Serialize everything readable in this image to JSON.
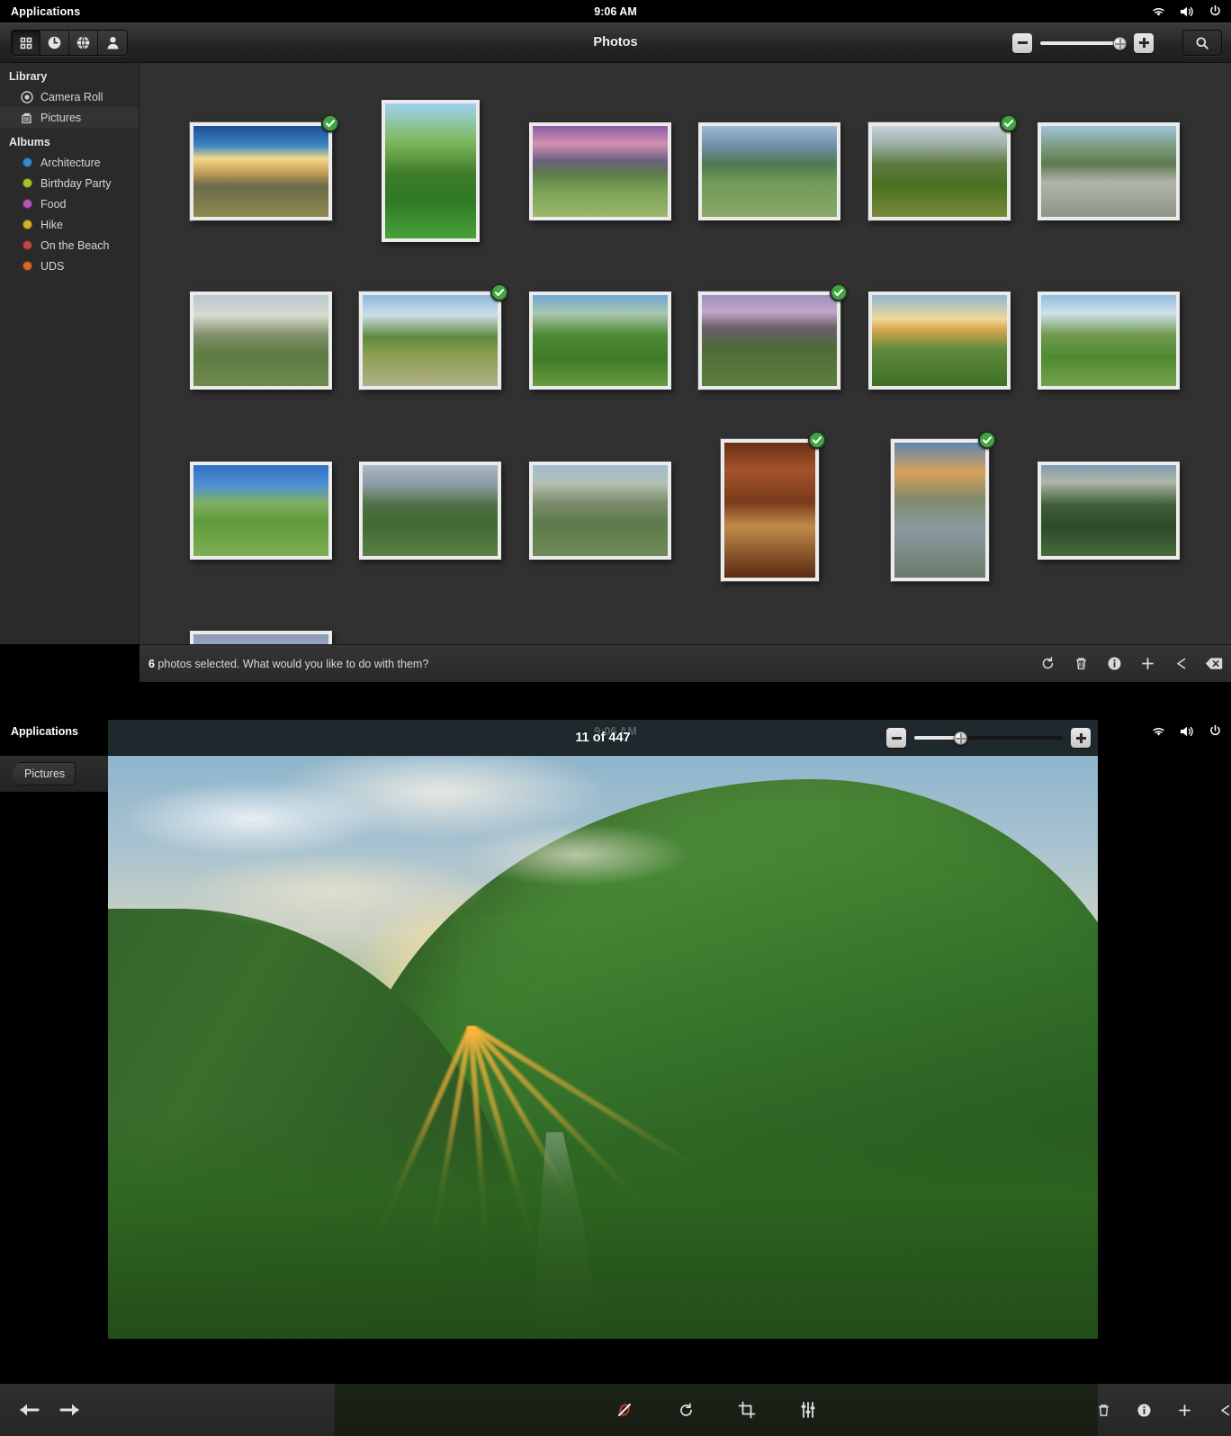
{
  "system": {
    "applications_label": "Applications",
    "clock": "9:06 AM",
    "tray_icons": [
      "wifi-icon",
      "volume-icon",
      "power-icon"
    ]
  },
  "window_grid": {
    "title": "Photos",
    "toolbar_buttons": [
      {
        "name": "grid-view-button",
        "icon": "grid-icon",
        "active": true
      },
      {
        "name": "recent-view-button",
        "icon": "clock-icon",
        "active": false
      },
      {
        "name": "places-view-button",
        "icon": "globe-icon",
        "active": false
      },
      {
        "name": "people-view-button",
        "icon": "person-icon",
        "active": false
      }
    ],
    "zoom": {
      "minus_label": "−",
      "plus_label": "+",
      "value_percent": 93
    },
    "search_icon": "search-icon",
    "sidebar": {
      "library_heading": "Library",
      "library_items": [
        {
          "label": "Camera Roll",
          "icon": "camera-roll-icon",
          "selected": false
        },
        {
          "label": "Pictures",
          "icon": "pictures-folder-icon",
          "selected": true
        }
      ],
      "albums_heading": "Albums",
      "albums": [
        {
          "label": "Architecture",
          "color": "#3a89c9"
        },
        {
          "label": "Birthday Party",
          "color": "#a5c32a"
        },
        {
          "label": "Food",
          "color": "#b martial"
        },
        {
          "label": "Hike",
          "color": "#d4b125"
        },
        {
          "label": "On the Beach",
          "color": "#bd4a45"
        },
        {
          "label": "UDS",
          "color": "#d4692a"
        }
      ]
    },
    "action_bar": {
      "count": "6",
      "message": " photos selected. What would you like to do with them?",
      "actions": [
        {
          "name": "rotate-button",
          "icon": "rotate-icon"
        },
        {
          "name": "delete-button",
          "icon": "trash-icon"
        },
        {
          "name": "properties-button",
          "icon": "info-icon"
        },
        {
          "name": "add-to-album-button",
          "icon": "plus-icon"
        },
        {
          "name": "share-button",
          "icon": "share-icon"
        },
        {
          "name": "deselect-button",
          "icon": "clear-selection-icon"
        }
      ]
    },
    "photos": [
      {
        "id": 1,
        "row": 0,
        "col": 0,
        "orientation": "landscape",
        "selected": true,
        "alt": "Sunset over rocky coastline"
      },
      {
        "id": 2,
        "row": 0,
        "col": 1,
        "orientation": "portrait",
        "selected": false,
        "alt": "Tree and boulders on green grass"
      },
      {
        "id": 3,
        "row": 0,
        "col": 2,
        "orientation": "landscape",
        "selected": false,
        "alt": "Purple sunset over field with tree"
      },
      {
        "id": 4,
        "row": 0,
        "col": 3,
        "orientation": "landscape",
        "selected": false,
        "alt": "Gravel path through green meadow"
      },
      {
        "id": 5,
        "row": 0,
        "col": 4,
        "orientation": "landscape",
        "selected": true,
        "alt": "Mountain ridge trail"
      },
      {
        "id": 6,
        "row": 0,
        "col": 5,
        "orientation": "landscape",
        "selected": false,
        "alt": "Rocky lake shore with mountains"
      },
      {
        "id": 7,
        "row": 1,
        "col": 0,
        "orientation": "landscape",
        "selected": false,
        "alt": "Hazy sunrise over valley"
      },
      {
        "id": 8,
        "row": 1,
        "col": 1,
        "orientation": "landscape",
        "selected": true,
        "alt": "Rocky stream with trees"
      },
      {
        "id": 9,
        "row": 1,
        "col": 2,
        "orientation": "landscape",
        "selected": false,
        "alt": "Green valley with wildflowers"
      },
      {
        "id": 10,
        "row": 1,
        "col": 3,
        "orientation": "landscape",
        "selected": true,
        "alt": "Purple sky over heather hillside"
      },
      {
        "id": 11,
        "row": 1,
        "col": 4,
        "orientation": "landscape",
        "selected": false,
        "alt": "Sunburst over green hill and stream"
      },
      {
        "id": 12,
        "row": 1,
        "col": 5,
        "orientation": "landscape",
        "selected": false,
        "alt": "Winding path through green hills"
      },
      {
        "id": 13,
        "row": 2,
        "col": 0,
        "orientation": "landscape",
        "selected": false,
        "alt": "Lone tree in blue sky meadow"
      },
      {
        "id": 14,
        "row": 2,
        "col": 1,
        "orientation": "landscape",
        "selected": false,
        "alt": "Overcast green mountain valley"
      },
      {
        "id": 15,
        "row": 2,
        "col": 2,
        "orientation": "landscape",
        "selected": false,
        "alt": "Rocky hillside with path"
      },
      {
        "id": 16,
        "row": 2,
        "col": 3,
        "orientation": "portrait",
        "selected": true,
        "alt": "Cathedral interior with arches"
      },
      {
        "id": 17,
        "row": 2,
        "col": 4,
        "orientation": "portrait",
        "selected": true,
        "alt": "Stone ridge at dusk"
      },
      {
        "id": 18,
        "row": 2,
        "col": 5,
        "orientation": "landscape",
        "selected": false,
        "alt": "River through dark green valley"
      },
      {
        "id": 19,
        "row": 3,
        "col": 0,
        "orientation": "landscape",
        "selected": false,
        "alt": "Cloudy blue sky"
      }
    ]
  },
  "window_photo": {
    "back_label": "Pictures",
    "title": "11 of 447",
    "zoom": {
      "minus_label": "−",
      "plus_label": "+",
      "value_percent": 31
    },
    "photo_alt": "Sunburst over green valley with stream and ferns",
    "nav": [
      {
        "name": "previous-photo-button",
        "icon": "arrow-left-icon"
      },
      {
        "name": "next-photo-button",
        "icon": "arrow-right-icon"
      }
    ],
    "edit_tools": [
      {
        "name": "red-eye-button",
        "icon": "red-eye-icon"
      },
      {
        "name": "rotate-button",
        "icon": "rotate-icon"
      },
      {
        "name": "crop-button",
        "icon": "crop-icon"
      },
      {
        "name": "adjust-button",
        "icon": "adjust-sliders-icon"
      }
    ],
    "right_tools": [
      {
        "name": "delete-button",
        "icon": "trash-icon"
      },
      {
        "name": "properties-button",
        "icon": "info-icon"
      },
      {
        "name": "add-to-album-button",
        "icon": "plus-icon"
      },
      {
        "name": "share-button",
        "icon": "share-icon"
      }
    ]
  }
}
